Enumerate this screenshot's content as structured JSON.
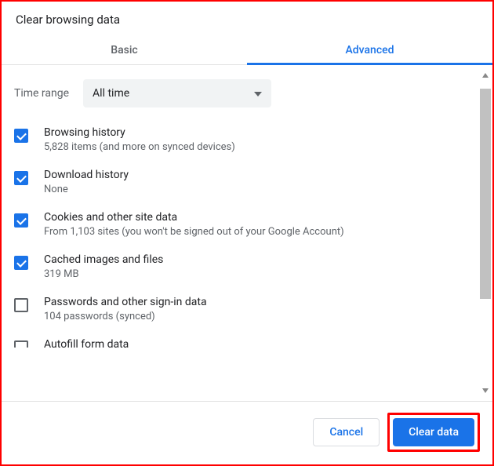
{
  "dialog": {
    "title": "Clear browsing data",
    "tabs": {
      "basic": "Basic",
      "advanced": "Advanced"
    },
    "time_range": {
      "label": "Time range",
      "selected": "All time"
    },
    "options": [
      {
        "title": "Browsing history",
        "sub": "5,828 items (and more on synced devices)",
        "checked": true
      },
      {
        "title": "Download history",
        "sub": "None",
        "checked": true
      },
      {
        "title": "Cookies and other site data",
        "sub": "From 1,103 sites (you won't be signed out of your Google Account)",
        "checked": true
      },
      {
        "title": "Cached images and files",
        "sub": "319 MB",
        "checked": true
      },
      {
        "title": "Passwords and other sign-in data",
        "sub": "104 passwords (synced)",
        "checked": false
      },
      {
        "title": "Autofill form data",
        "sub": "",
        "checked": false
      }
    ],
    "buttons": {
      "cancel": "Cancel",
      "clear": "Clear data"
    }
  }
}
